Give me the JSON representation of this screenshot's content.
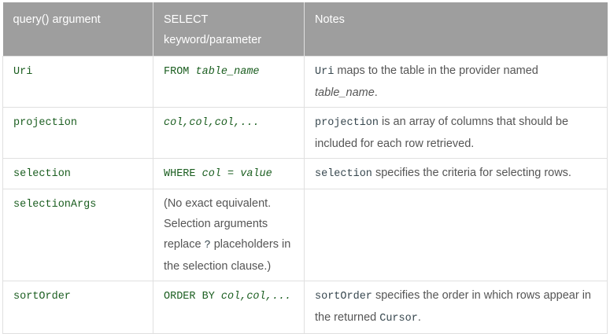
{
  "header": {
    "col1": "query() argument",
    "col2_line1": "SELECT",
    "col2_line2": "keyword/parameter",
    "col3": "Notes"
  },
  "rows": {
    "uri": {
      "arg": "Uri",
      "sql_kw": "FROM",
      "sql_param": "table_name",
      "note_code": "Uri",
      "note_text1": " maps to the table in the provider named",
      "note_ital": "table_name",
      "note_text2": "."
    },
    "projection": {
      "arg": "projection",
      "sql_param": "col,col,col,...",
      "note_code": "projection",
      "note_text": " is an array of columns that should be included for each row retrieved."
    },
    "selection": {
      "arg": "selection",
      "sql_kw": "WHERE",
      "sql_param1": "col",
      "sql_eq": " = ",
      "sql_param2": "value",
      "note_code": "selection",
      "note_text": " specifies the criteria for selecting rows."
    },
    "selectionArgs": {
      "arg": "selectionArgs",
      "text1": "(No exact equivalent. Selection arguments replace ",
      "code": "?",
      "text2": " placeholders in the selection clause.)",
      "note": ""
    },
    "sortOrder": {
      "arg": "sortOrder",
      "sql_kw": "ORDER BY",
      "sql_param": "col,col,...",
      "note_code": "sortOrder",
      "note_text1": " specifies the order in which rows appear in the returned ",
      "note_link": "Cursor",
      "note_text2": "."
    }
  }
}
